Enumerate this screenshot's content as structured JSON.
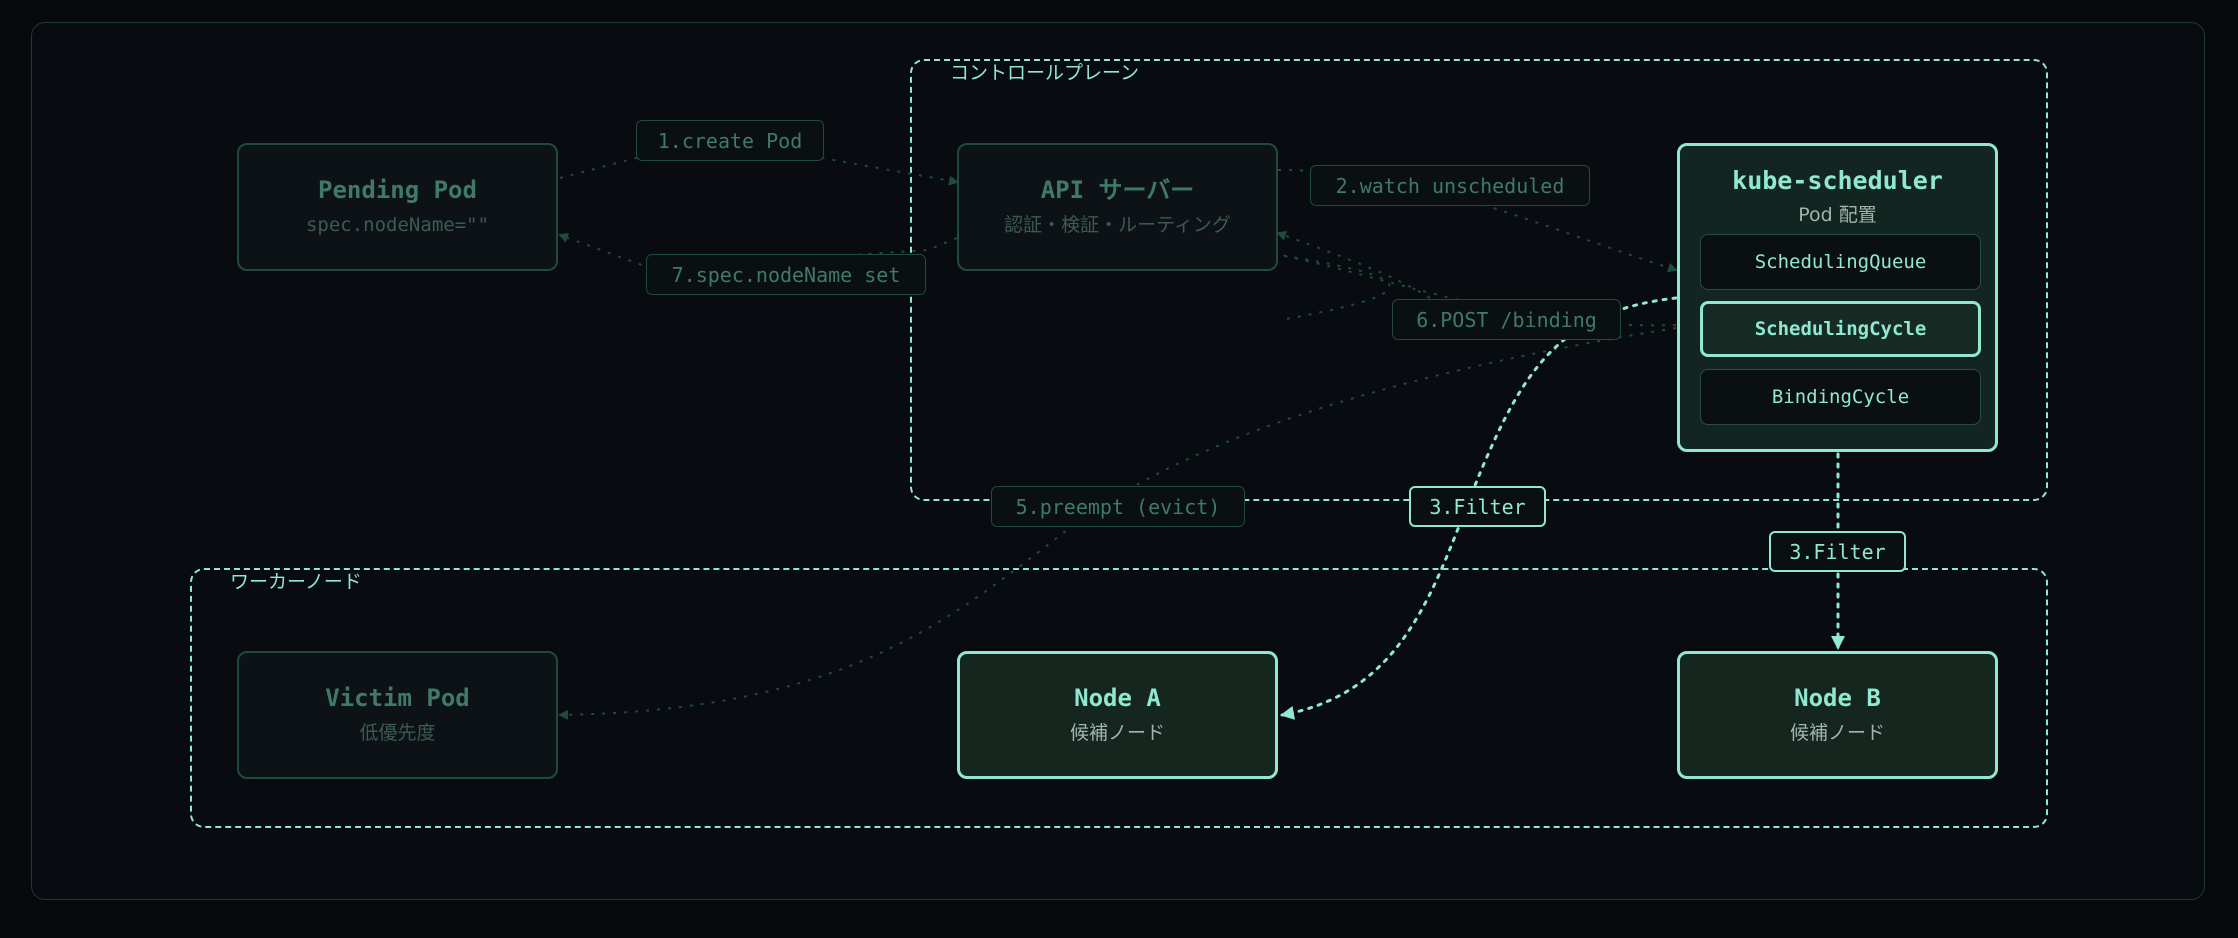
{
  "groups": {
    "control_plane": "コントロールプレーン",
    "worker_nodes": "ワーカーノード"
  },
  "nodes": {
    "pending_pod": {
      "title": "Pending Pod",
      "subtitle": "spec.nodeName=\"\""
    },
    "api_server": {
      "title": "API サーバー",
      "subtitle": "認証・検証・ルーティング"
    },
    "victim_pod": {
      "title": "Victim Pod",
      "subtitle": "低優先度"
    },
    "node_a": {
      "title": "Node A",
      "subtitle": "候補ノード"
    },
    "node_b": {
      "title": "Node B",
      "subtitle": "候補ノード"
    }
  },
  "scheduler": {
    "title": "kube-scheduler",
    "subtitle": "Pod 配置",
    "components": [
      "SchedulingQueue",
      "SchedulingCycle",
      "BindingCycle"
    ]
  },
  "edges": {
    "create_pod": "1.create Pod",
    "watch": "2.watch unscheduled",
    "filter_a": "3.Filter",
    "filter_b": "3.Filter",
    "preempt": "5.preempt (evict)",
    "post_binding": "6.POST /binding",
    "node_name_set": "7.spec.nodeName set"
  },
  "colors": {
    "accent": "#8fe8cf",
    "dim_border": "#1f4a3c",
    "background": "#07090c"
  }
}
